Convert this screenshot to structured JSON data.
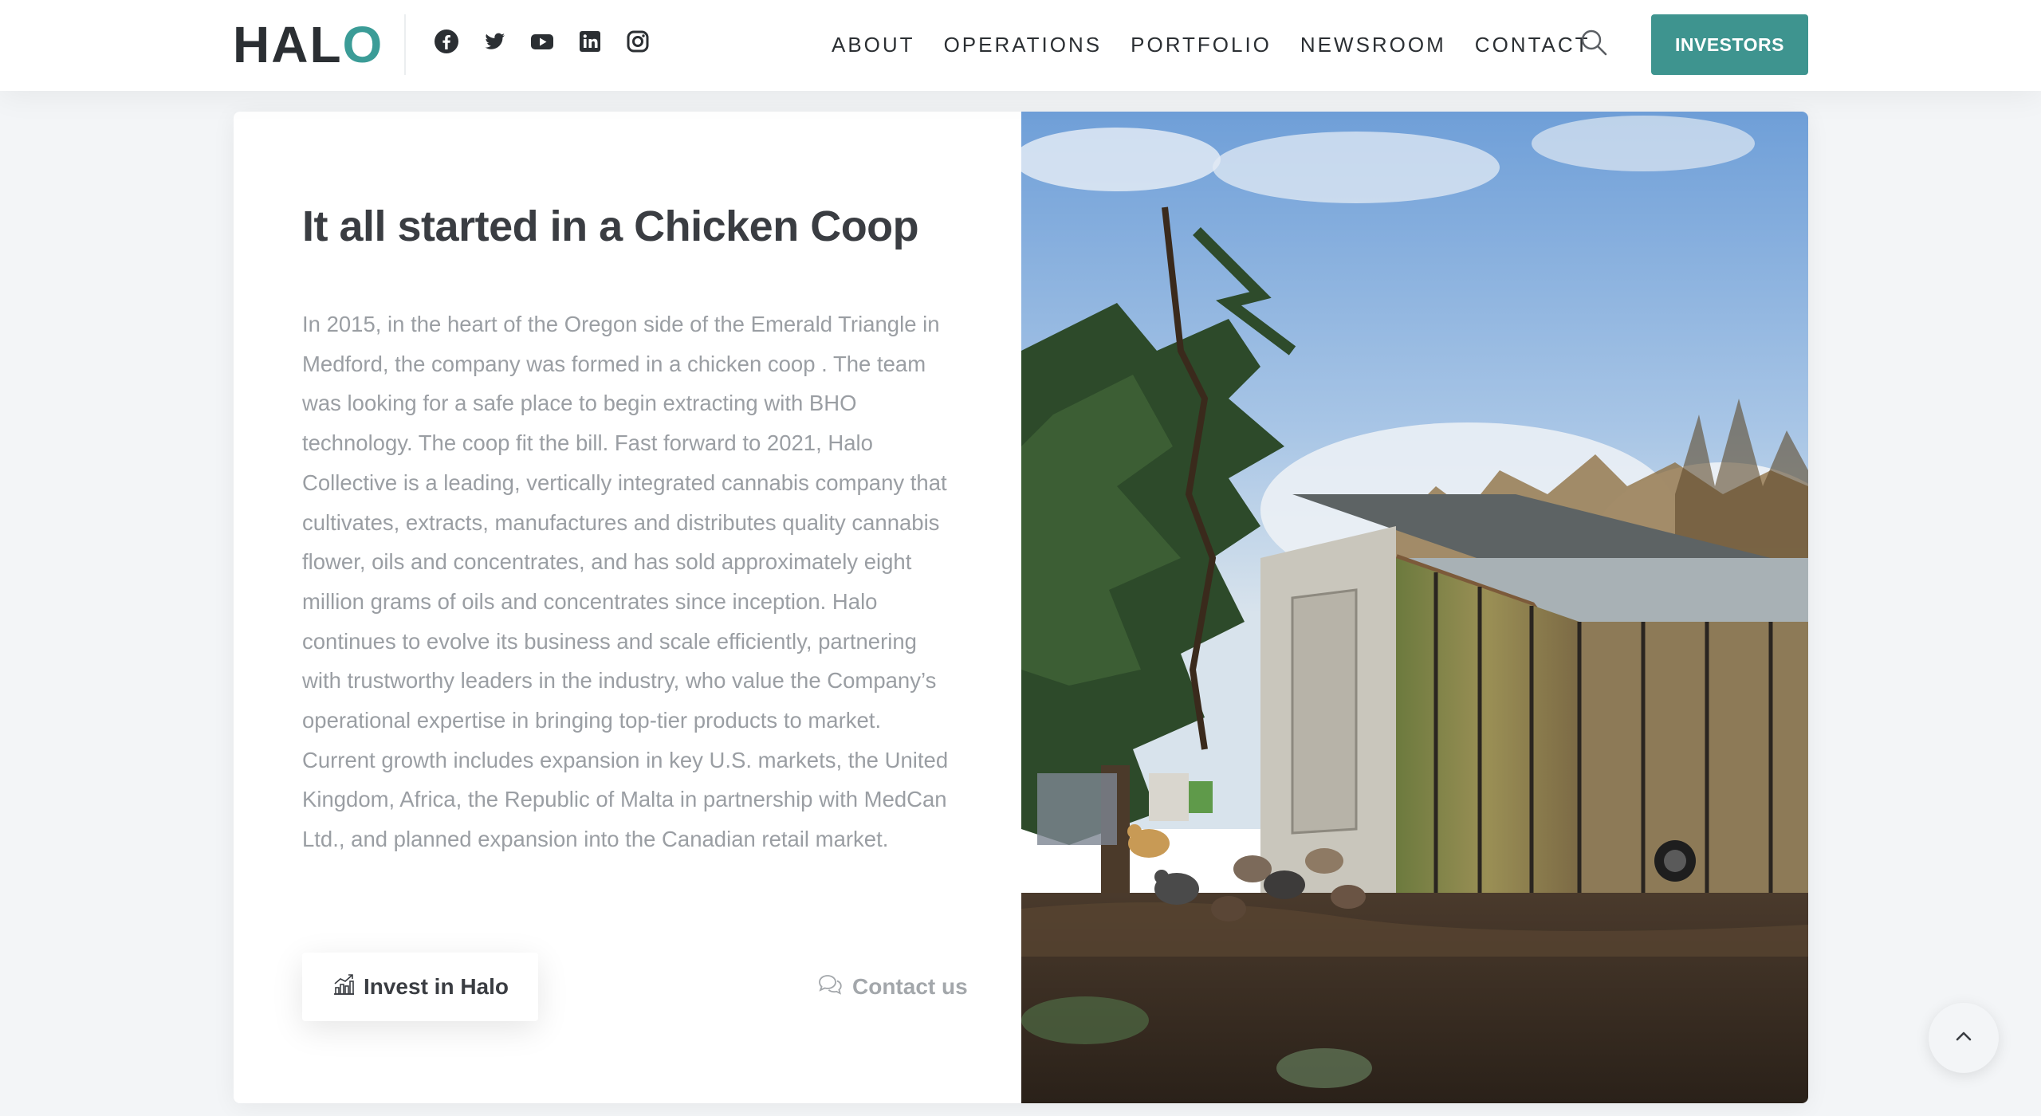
{
  "header": {
    "logo": {
      "text_main": "HAL",
      "text_accent": "O",
      "alt": "HALO"
    },
    "social_icons": [
      "facebook-icon",
      "twitter-icon",
      "youtube-icon",
      "linkedin-icon",
      "instagram-icon"
    ],
    "nav": [
      "ABOUT",
      "OPERATIONS",
      "PORTFOLIO",
      "NEWSROOM",
      "CONTACT"
    ],
    "search_icon": "search-icon",
    "investors_label": "INVESTORS"
  },
  "main": {
    "headline": "It all started in a Chicken Coop",
    "body": "In 2015, in the heart of the Oregon side of the Emerald Triangle in Medford, the company was formed in a chicken coop . The team was looking for a safe place to begin extracting with BHO technology. The coop fit the bill. Fast forward to 2021, Halo Collective is a leading, vertically integrated cannabis company that cultivates, extracts, manufactures and distributes quality cannabis flower, oils and concentrates, and has sold approximately eight million grams of oils and concentrates since inception. Halo continues to evolve its business and scale efficiently, partnering with trustworthy leaders in the industry, who value the Company’s operational expertise in bringing top-tier products to market. Current growth includes expansion in key U.S. markets, the United Kingdom, Africa, the Republic of Malta in partnership with MedCan Ltd., and planned expansion into the Canadian retail market.",
    "invest_button": "Invest in Halo",
    "contact_link": "Contact us",
    "photo_subject": "chicken coop with chickens under trees"
  },
  "scroll_top_icon": "chevron-up-icon",
  "colors": {
    "accent": "#3e948f",
    "logo_o": "#3b9c97",
    "heading": "#3a3d42",
    "body_text": "#9a9ea3",
    "background": "#f3f5f7"
  }
}
